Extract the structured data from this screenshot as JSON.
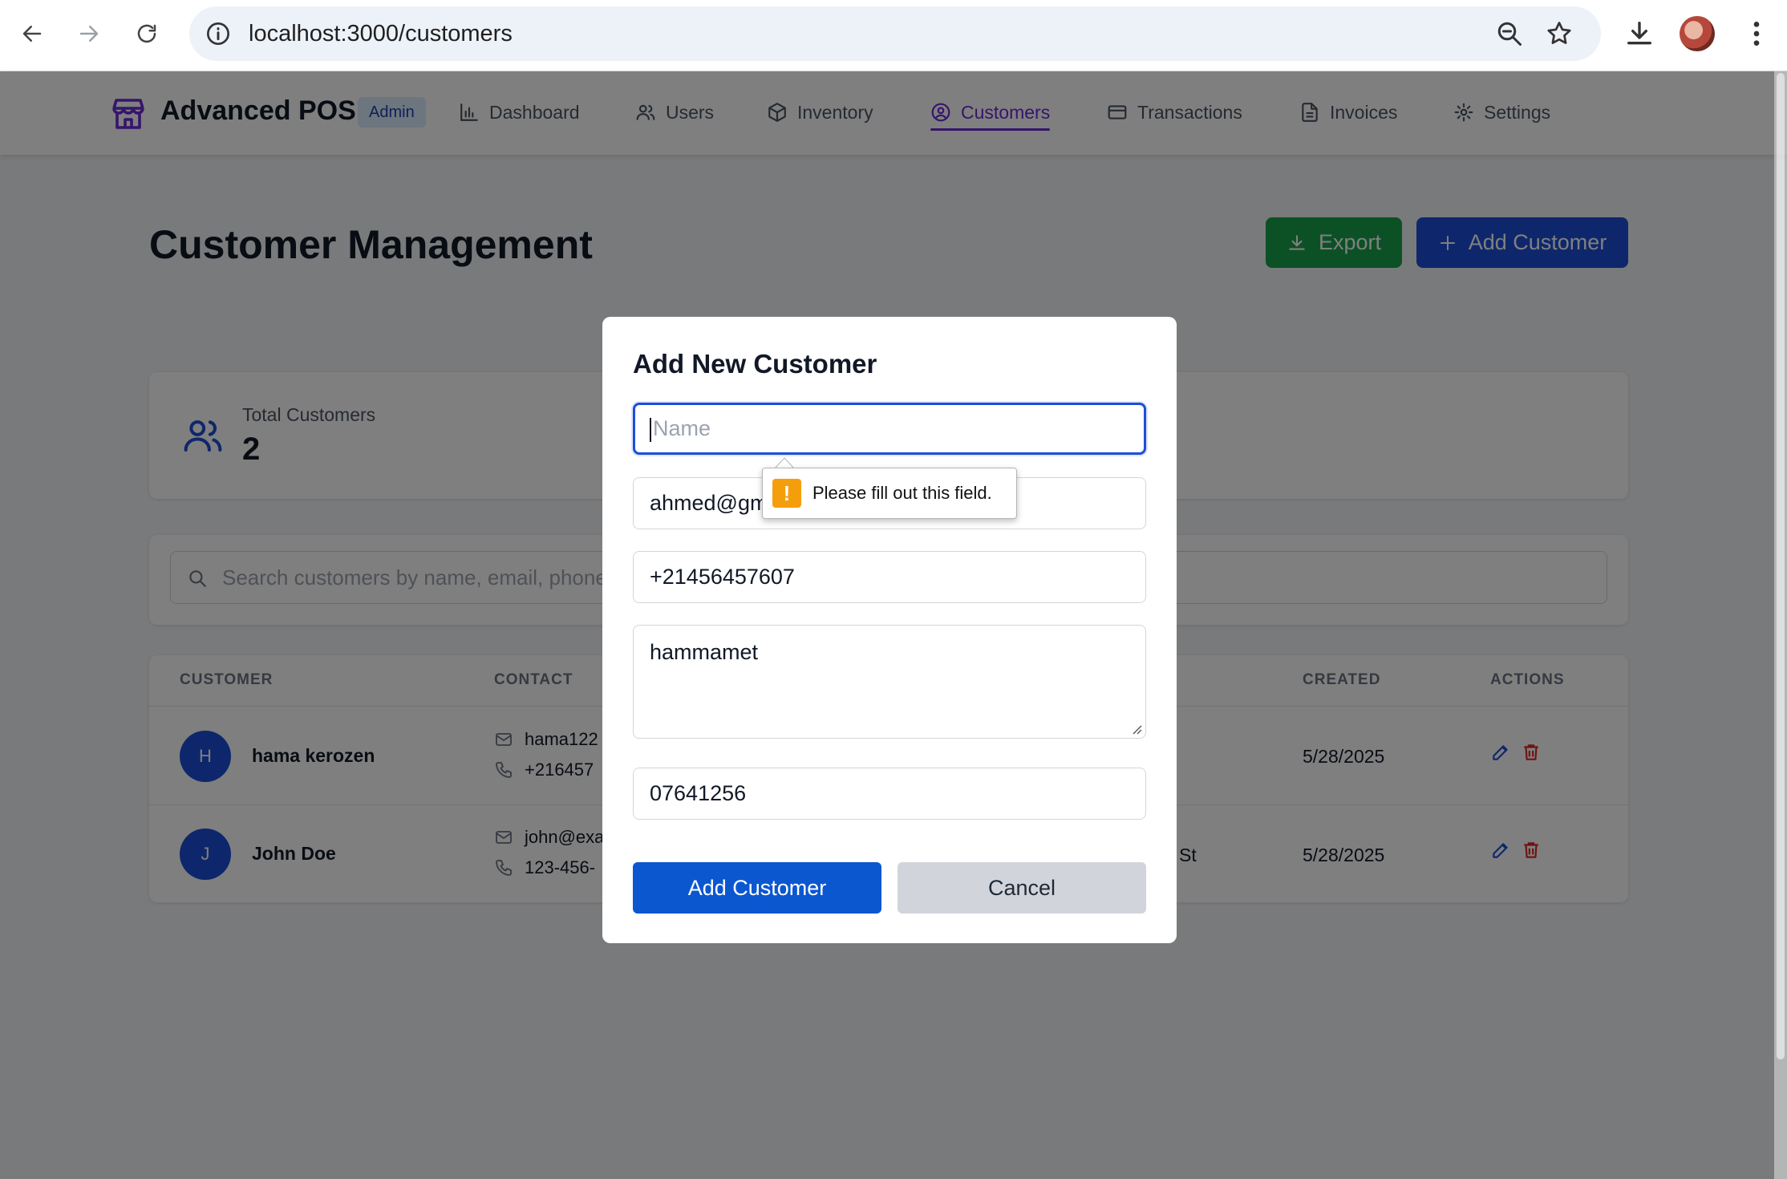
{
  "browser": {
    "url": "localhost:3000/customers"
  },
  "header": {
    "brand": "Advanced POS",
    "role_badge": "Admin",
    "nav": [
      {
        "label": "Dashboard",
        "icon": "bar-chart-icon"
      },
      {
        "label": "Users",
        "icon": "users-icon"
      },
      {
        "label": "Inventory",
        "icon": "box-icon"
      },
      {
        "label": "Customers",
        "icon": "user-circle-icon",
        "active": true
      },
      {
        "label": "Transactions",
        "icon": "credit-card-icon"
      },
      {
        "label": "Invoices",
        "icon": "file-icon"
      },
      {
        "label": "Settings",
        "icon": "gear-icon"
      }
    ]
  },
  "page": {
    "title": "Customer Management",
    "export_label": "Export",
    "add_label": "Add Customer"
  },
  "stats": {
    "total_label": "Total Customers",
    "total_value": "2"
  },
  "search": {
    "placeholder": "Search customers by name, email, phone"
  },
  "table": {
    "headers": {
      "customer": "CUSTOMER",
      "contact": "CONTACT",
      "created": "CREATED",
      "actions": "ACTIONS"
    },
    "rows": [
      {
        "initial": "H",
        "name": "hama kerozen",
        "email": "hama122",
        "phone": "+216457",
        "address_tail": "",
        "created": "5/28/2025"
      },
      {
        "initial": "J",
        "name": "John Doe",
        "email": "john@exa",
        "phone": "123-456-",
        "address_tail": "St",
        "created": "5/28/2025"
      }
    ]
  },
  "modal": {
    "title": "Add New Customer",
    "name_placeholder": "Name",
    "email_value": "ahmed@gm",
    "phone_value": "+21456457607",
    "address_value": "hammamet",
    "extra_value": "07641256",
    "submit_label": "Add Customer",
    "cancel_label": "Cancel"
  },
  "validation": {
    "message": "Please fill out this field."
  },
  "colors": {
    "primary": "#1d4ed8",
    "export": "#16a34a",
    "nav_active": "#6d28d9",
    "danger": "#dc2626",
    "warning": "#f59e0b"
  }
}
